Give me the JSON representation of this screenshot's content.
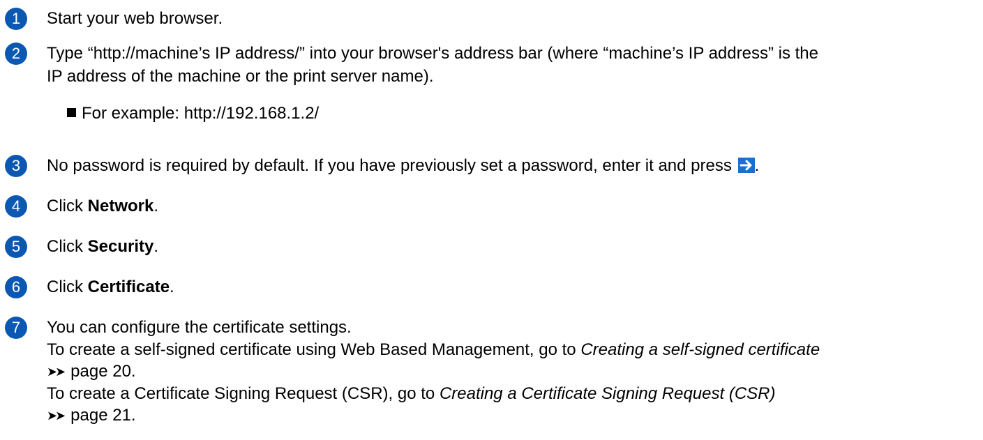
{
  "steps": [
    {
      "number": "1",
      "text": "Start your web browser."
    },
    {
      "number": "2",
      "text_line1": "Type “http://machine’s IP address/” into your browser's address bar (where “machine’s IP address” is the",
      "text_line2": "IP address of the machine or the print server name).",
      "bullet": "For example: http://192.168.1.2/"
    },
    {
      "number": "3",
      "text": "No password is required by default. If you have previously set a password, enter it and press ",
      "icon": "arrow-right-icon",
      "suffix": "."
    },
    {
      "number": "4",
      "prefix": "Click ",
      "bold": "Network",
      "suffix": "."
    },
    {
      "number": "5",
      "prefix": "Click ",
      "bold": "Security",
      "suffix": "."
    },
    {
      "number": "6",
      "prefix": "Click ",
      "bold": "Certificate",
      "suffix": "."
    },
    {
      "number": "7",
      "line1": "You can configure the certificate settings.",
      "line2_prefix": "To create a self-signed certificate using Web Based Management, go to ",
      "line2_link": "Creating a self-signed certificate",
      "line3_marker": "➤➤",
      "line3_text": "page 20.",
      "line4_prefix": "To create a Certificate Signing Request (CSR), go to ",
      "line4_link": "Creating a Certificate Signing Request (CSR)",
      "line5_marker": "➤➤",
      "line5_text": "page 21."
    }
  ],
  "colors": {
    "badge": "#0b58b3",
    "icon_bg": "#1a6fd0"
  }
}
